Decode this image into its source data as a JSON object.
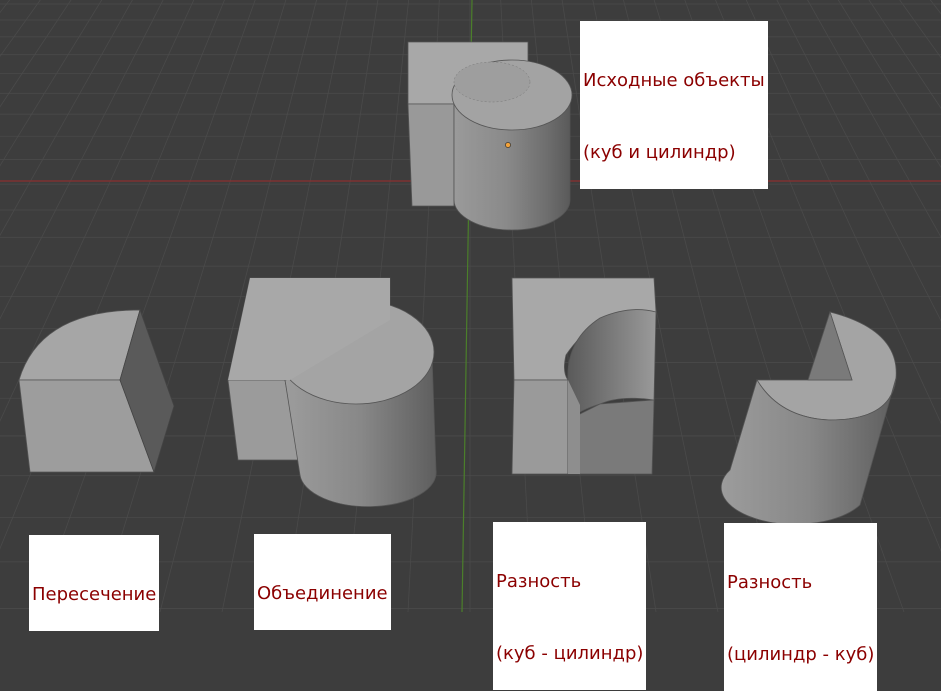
{
  "scene": {
    "background": "#3d3d3d",
    "grid_color": "#4a4a4a",
    "axis_x_color": "#8c2f2f",
    "axis_y_color": "#4b7f2a",
    "label_text_color": "#8b0000",
    "label_bg_color": "#ffffff",
    "origin_marker_color": "#f2a23a"
  },
  "labels": {
    "source": {
      "line1": "Исходные объекты",
      "line2": "(куб и цилиндр)"
    },
    "intersection": {
      "line1": "Пересечение"
    },
    "union": {
      "line1": "Объединение"
    },
    "difference_cube_cyl": {
      "line1": "Разность",
      "line2": "(куб - цилиндр)"
    },
    "difference_cyl_cube": {
      "line1": "Разность",
      "line2": "(цилиндр - куб)"
    }
  }
}
